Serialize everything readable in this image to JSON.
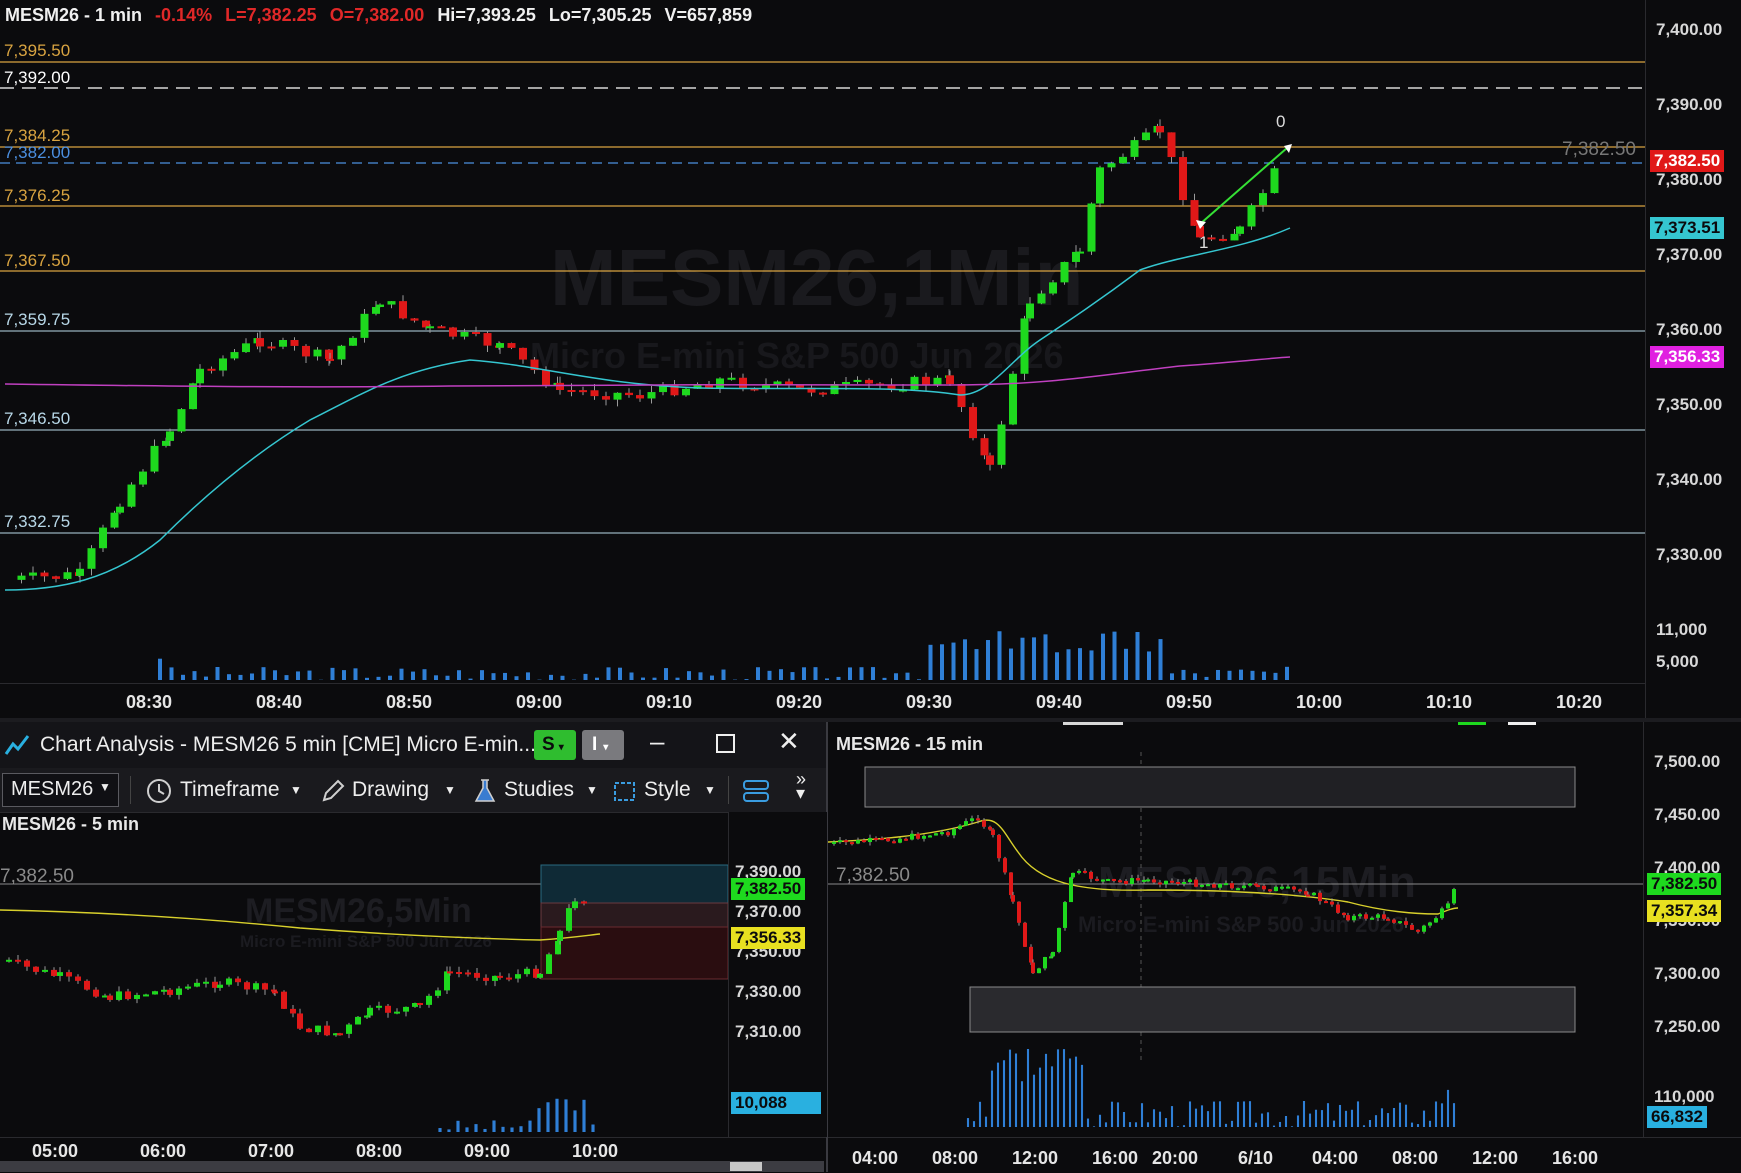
{
  "main_chart": {
    "header": {
      "symbol_tf": "MESM26 - 1 min",
      "change": "-0.14%",
      "last": "L=7,382.25",
      "open": "O=7,382.00",
      "high": "Hi=7,393.25",
      "low": "Lo=7,305.25",
      "volume": "V=657,859"
    },
    "watermark": "MESM26,1Min",
    "watermark_sub": "Micro E-mini S&P 500 Jun 2026",
    "level_labels": [
      {
        "text": "7,395.50",
        "color": "#d9a441"
      },
      {
        "text": "7,392.00",
        "color": "#ffffff"
      },
      {
        "text": "7,384.25",
        "color": "#d9a441"
      },
      {
        "text": "7,382.00",
        "color": "#4b8fe0"
      },
      {
        "text": "7,376.25",
        "color": "#d9a441"
      },
      {
        "text": "7,367.50",
        "color": "#d9a441"
      },
      {
        "text": "7,359.75",
        "color": "#b8d8e8"
      },
      {
        "text": "7,346.50",
        "color": "#b8d8e8"
      },
      {
        "text": "7,332.75",
        "color": "#b8d8e8"
      }
    ],
    "price_axis": [
      "7,400.00",
      "7,390.00",
      "7,380.00",
      "7,370.00",
      "7,360.00",
      "7,350.00",
      "7,340.00",
      "7,330.00"
    ],
    "volume_axis": [
      "11,000",
      "5,000"
    ],
    "time_axis": [
      "08:30",
      "08:40",
      "08:50",
      "09:00",
      "09:10",
      "09:20",
      "09:30",
      "09:40",
      "09:50",
      "10:00",
      "10:10",
      "10:20"
    ],
    "badges": {
      "last_price": "7,382.50",
      "ema_fast": "7,373.51",
      "ema_slow": "7,356.33"
    },
    "last_price_marker": "7,382.50",
    "drawing_labels": {
      "start": "1",
      "end": "0"
    }
  },
  "chart_window": {
    "title": "Chart Analysis - MESM26 5 min [CME] Micro E-min...",
    "btn_s": "S",
    "btn_i": "I",
    "toolbar": {
      "symbol": "MESM26",
      "timeframe": "Timeframe",
      "drawing": "Drawing",
      "studies": "Studies",
      "style": "Style"
    },
    "chart_title": "MESM26 - 5 min",
    "watermark": "MESM26,5Min",
    "watermark_sub": "Micro E-mini S&P 500 Jun 2026",
    "last_price_marker": "7,382.50",
    "price_axis": [
      "7,390.00",
      "7,370.00",
      "7,350.00",
      "7,330.00",
      "7,310.00"
    ],
    "badges": {
      "last_price": "7,382.50",
      "ema": "7,356.33",
      "volume": "10,088"
    },
    "time_axis": [
      "05:00",
      "06:00",
      "07:00",
      "08:00",
      "09:00",
      "10:00"
    ]
  },
  "chart_15": {
    "chart_title": "MESM26 - 15 min",
    "watermark": "MESM26,15Min",
    "watermark_sub": "Micro E-mini S&P 500 Jun 2026",
    "last_price_marker": "7,382.50",
    "price_axis": [
      "7,500.00",
      "7,450.00",
      "7,400.00",
      "7,350.00",
      "7,300.00",
      "7,250.00"
    ],
    "volume_axis": [
      "110,000",
      "66,832"
    ],
    "badges": {
      "last_price": "7,382.50",
      "ema": "7,357.34",
      "volume": "66,832"
    },
    "time_axis": [
      "04:00",
      "08:00",
      "12:00",
      "16:00",
      "20:00",
      "6/10",
      "04:00",
      "08:00",
      "12:00",
      "16:00"
    ]
  },
  "colors": {
    "up": "#1ed91e",
    "down": "#e01818",
    "gold": "#d9a441",
    "cyan": "#35c6d0",
    "magenta": "#c040c0",
    "yellow": "#d8d02c"
  }
}
